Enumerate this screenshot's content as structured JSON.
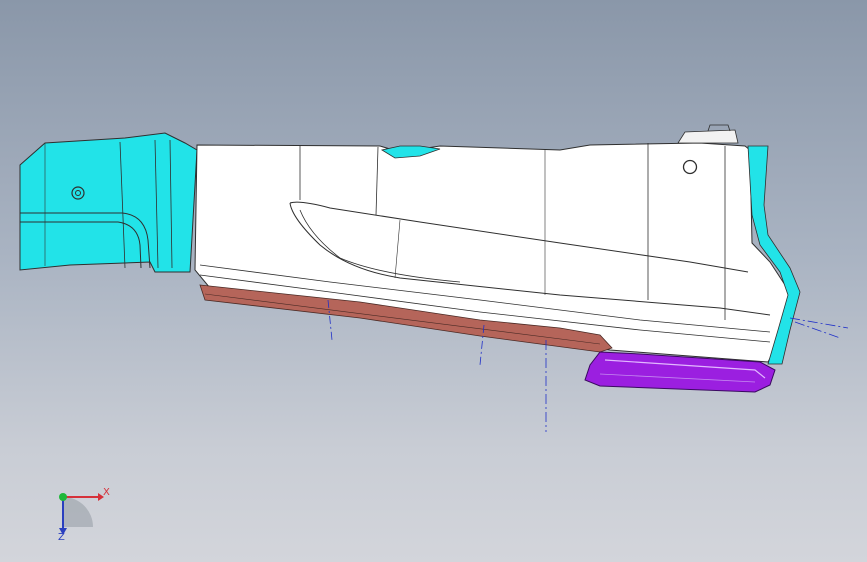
{
  "viewport": {
    "background_top": "#8a97a9",
    "background_bottom": "#d3d5db"
  },
  "model": {
    "colors": {
      "cyan_part": "#22e3e8",
      "white_panel": "#ffffff",
      "brown_strip": "#b5655a",
      "purple_part": "#9b1fe0",
      "edge_lines": "#2f2f2f",
      "axis_lines": "#2030c8"
    }
  },
  "triad": {
    "x_label": "X",
    "y_label": "Z",
    "x_color": "#d6313a",
    "y_color": "#2a3fbf",
    "origin_color": "#1fb83a"
  }
}
